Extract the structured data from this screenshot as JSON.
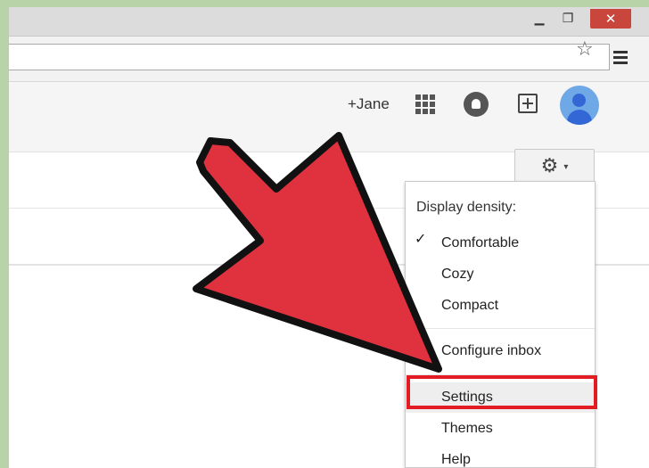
{
  "window": {
    "controls": {
      "minimize": "▁",
      "maximize": "❐",
      "close": "✕"
    }
  },
  "toolbar": {
    "bookmark_icon": "star-icon",
    "menu_icon": "hamburger-icon"
  },
  "gbar": {
    "user_link": "+Jane",
    "icons": [
      "apps-grid-icon",
      "notifications-icon",
      "share-icon",
      "avatar"
    ]
  },
  "settings_button": {
    "gear": "⚙",
    "caret": "▾"
  },
  "menu": {
    "header": "Display density:",
    "density": [
      {
        "label": "Comfortable",
        "checked": true
      },
      {
        "label": "Cozy",
        "checked": false
      },
      {
        "label": "Compact",
        "checked": false
      }
    ],
    "check_mark": "✓",
    "configure": "Configure inbox",
    "settings": "Settings",
    "themes": "Themes",
    "help": "Help"
  },
  "colors": {
    "arrow_fill": "#e0313f",
    "highlight_border": "#e31b23",
    "close_button": "#c9463d",
    "avatar": "#6fa8e6"
  }
}
